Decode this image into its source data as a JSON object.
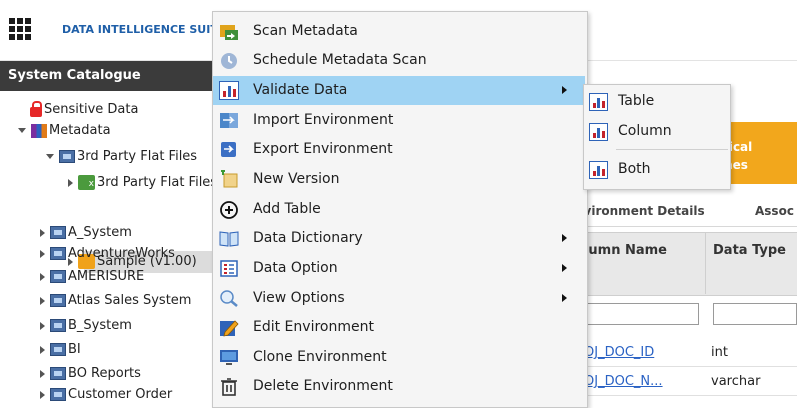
{
  "header": {
    "app_title": "DATA INTELLIGENCE SUITE",
    "grid_icon": "grid-icon"
  },
  "catalogue": {
    "title": "System Catalogue",
    "tree": [
      {
        "label": "Sensitive Data",
        "icon": "lock-icon"
      },
      {
        "label": "Metadata",
        "icon": "metadata-icon"
      },
      {
        "label": "3rd Party Flat Files",
        "icon": "database-icon"
      },
      {
        "label": "3rd Party Flat Files",
        "icon": "flat-file-icon"
      },
      {
        "label": "Sample (v1.00)",
        "icon": "sample-icon"
      },
      {
        "label": "A_System",
        "icon": "database-icon"
      },
      {
        "label": "AdventureWorks",
        "icon": "database-icon"
      },
      {
        "label": "AMERISURE",
        "icon": "database-icon"
      },
      {
        "label": "Atlas Sales System",
        "icon": "database-icon"
      },
      {
        "label": "B_System",
        "icon": "database-icon"
      },
      {
        "label": "BI",
        "icon": "database-icon"
      },
      {
        "label": "BO Reports",
        "icon": "database-icon"
      },
      {
        "label": "Customer Order",
        "icon": "database-icon"
      }
    ]
  },
  "context_menu": {
    "items": [
      {
        "label": "Scan Metadata",
        "icon": "scan-icon"
      },
      {
        "label": "Schedule Metadata Scan",
        "icon": "clock-icon"
      },
      {
        "label": "Validate Data",
        "icon": "chart-icon"
      },
      {
        "label": "Import Environment",
        "icon": "import-icon"
      },
      {
        "label": "Export Environment",
        "icon": "export-icon"
      },
      {
        "label": "New Version",
        "icon": "new-version-icon"
      },
      {
        "label": "Add Table",
        "icon": "plus-circle-icon"
      },
      {
        "label": "Data Dictionary",
        "icon": "book-icon"
      },
      {
        "label": "Data Option",
        "icon": "data-option-icon"
      },
      {
        "label": "View Options",
        "icon": "magnifier-icon"
      },
      {
        "label": "Edit Environment",
        "icon": "pencil-icon"
      },
      {
        "label": "Clone Environment",
        "icon": "monitor-icon"
      },
      {
        "label": "Delete Environment",
        "icon": "trash-icon"
      }
    ]
  },
  "submenu": {
    "items": [
      {
        "label": "Table",
        "icon": "chart-icon"
      },
      {
        "label": "Column",
        "icon": "chart-icon"
      },
      {
        "label": "Both",
        "icon": "chart-icon"
      }
    ]
  },
  "main": {
    "tab_card": {
      "line1": "ogical",
      "line2": "ames"
    },
    "tabs": {
      "env_details": "nvironment Details",
      "assoc": "Assoc"
    },
    "table": {
      "headers": {
        "column_name": "olumn Name",
        "data_type": "Data Type"
      },
      "rows": [
        {
          "column_name": "ROJ_DOC_ID",
          "data_type": "int"
        },
        {
          "column_name": "ROJ_DOC_N...",
          "data_type": "varchar"
        }
      ]
    }
  },
  "colors": {
    "menu_highlight": "#9fd3f3",
    "tab_card": "#f2a71c",
    "header_dark": "#3b3b3b",
    "link": "#2a62c4"
  }
}
